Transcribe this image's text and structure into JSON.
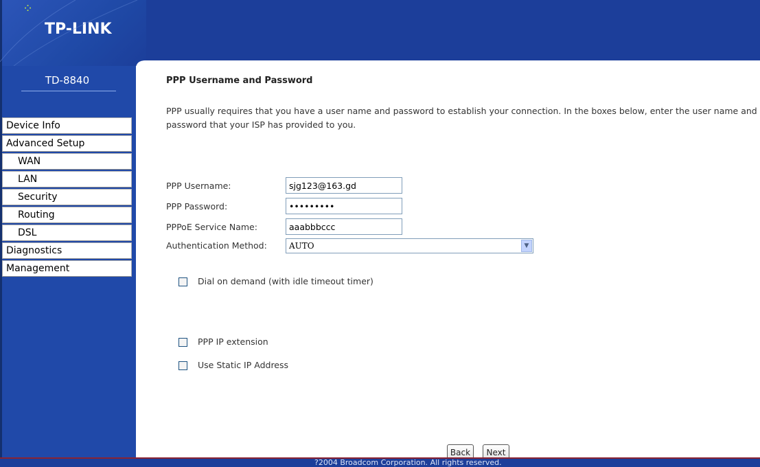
{
  "header": {
    "brand": "TP-LINK",
    "model": "TD-8840"
  },
  "sidebar": {
    "items": [
      {
        "label": "Device Info",
        "level": 0
      },
      {
        "label": "Advanced Setup",
        "level": 0
      },
      {
        "label": "WAN",
        "level": 1
      },
      {
        "label": "LAN",
        "level": 1
      },
      {
        "label": "Security",
        "level": 1
      },
      {
        "label": "Routing",
        "level": 1
      },
      {
        "label": "DSL",
        "level": 1
      },
      {
        "label": "Diagnostics",
        "level": 0
      },
      {
        "label": "Management",
        "level": 0
      }
    ]
  },
  "main": {
    "title": "PPP Username and Password",
    "intro": "PPP usually requires that you have a user name and password to establish your connection. In the boxes below, enter the user name and password that your ISP has provided to you.",
    "fields": {
      "username_label": "PPP Username:",
      "username_value": "sjg123@163.gd",
      "password_label": "PPP Password:",
      "password_value": "•••••••••",
      "service_label": "PPPoE Service Name:",
      "service_value": "aaabbbccc",
      "auth_label": "Authentication Method:",
      "auth_value": "AUTO"
    },
    "checkboxes": {
      "dial_on_demand": "Dial on demand (with idle timeout timer)",
      "ppp_ip_extension": "PPP IP extension",
      "static_ip": "Use Static IP Address"
    },
    "buttons": {
      "back": "Back",
      "next": "Next"
    }
  },
  "footer": {
    "text": "?2004 Broadcom Corporation. All rights reserved."
  },
  "colors": {
    "header_blue": "#1c3e9a",
    "sidebar_blue": "#2049a9",
    "footer_border": "#8a2332"
  }
}
